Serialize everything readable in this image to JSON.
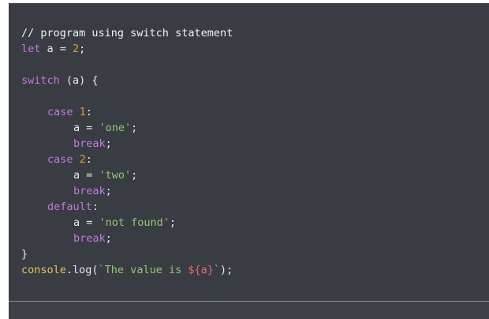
{
  "code": {
    "comment": "// program using switch statement",
    "let_kw": "let",
    "a_decl": " a = ",
    "two_val": "2",
    "semicolon": ";",
    "switch_kw": "switch",
    "switch_cond": " (a) {",
    "case_kw": "case",
    "case1_val": " 1",
    "colon": ":",
    "assign_a": "a = ",
    "str_one": "'one'",
    "break_kw": "break",
    "case2_val": " 2",
    "str_two": "'two'",
    "default_kw": "default",
    "str_notfound": "'not found'",
    "close_brace": "}",
    "console_obj": "console",
    "dot_log": ".log(",
    "tpl_text": "`The value is ",
    "tpl_expr": "${a}",
    "tpl_end": "`",
    "close_call": ");"
  }
}
